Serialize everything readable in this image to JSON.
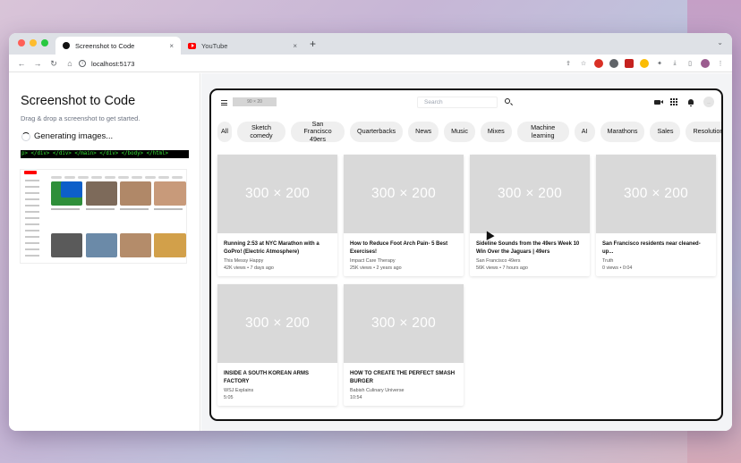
{
  "browser": {
    "tabs": [
      {
        "label": "Screenshot to Code",
        "close": "×"
      },
      {
        "label": "YouTube",
        "close": "×"
      }
    ],
    "new_tab": "+",
    "tab_menu": "⌄",
    "nav": {
      "back": "←",
      "forward": "→",
      "reload": "↻",
      "home": "⌂"
    },
    "url": "localhost:5173"
  },
  "left_panel": {
    "title": "Screenshot to Code",
    "subtitle": "Drag & drop a screenshot to get started.",
    "status": "Generating images...",
    "code_line": "p> </div> </div> </main> </div> </body> </html>"
  },
  "preview": {
    "logo_placeholder": "90 × 20",
    "search_placeholder": "Search",
    "avatar_placeholder": "...",
    "chips": [
      "All",
      "Sketch comedy",
      "San Francisco 49ers",
      "Quarterbacks",
      "News",
      "Music",
      "Mixes",
      "Machine learning",
      "AI",
      "Marathons",
      "Sales",
      "Resolutions"
    ],
    "videos": [
      {
        "thumb": "300 × 200",
        "title": "Running 2:53 at NYC Marathon with a GoPro! (Electric Atmosphere)",
        "channel": "This Messy Happy",
        "meta": "42K views • 7 days ago"
      },
      {
        "thumb": "300 × 200",
        "title": "How to Reduce Foot Arch Pain- 5 Best Exercises!",
        "channel": "Impact Care Therapy",
        "meta": "25K views • 2 years ago"
      },
      {
        "thumb": "300 × 200",
        "title": "Sideline Sounds from the 49ers Week 10 Win Over the Jaguars | 49ers",
        "channel": "San Francisco 49ers",
        "meta": "56K views • 7 hours ago"
      },
      {
        "thumb": "300 × 200",
        "title": "San Francisco residents near cleaned-up...",
        "channel": "Truth",
        "meta": "0 views • 0:04"
      },
      {
        "thumb": "300 × 200",
        "title": "INSIDE A SOUTH KOREAN ARMS FACTORY",
        "channel": "WSJ Explains",
        "meta": "5:05"
      },
      {
        "thumb": "300 × 200",
        "title": "HOW TO CREATE THE PERFECT SMASH BURGER",
        "channel": "Babish Culinary Universe",
        "meta": "10:54"
      }
    ]
  }
}
